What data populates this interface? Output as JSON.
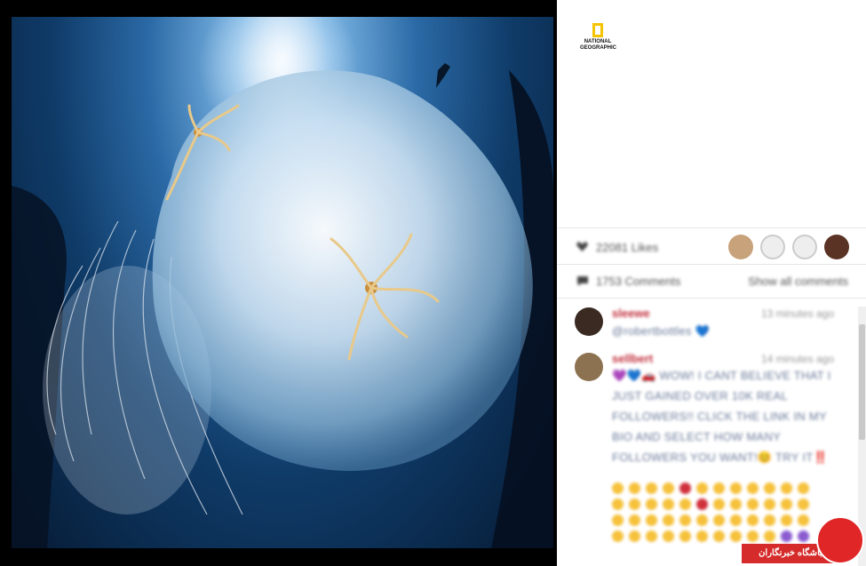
{
  "post": {
    "brand": "NATIONAL GEOGRAPHIC",
    "likes_text": "22081 Likes",
    "comments_text": "1753 Comments",
    "show_all_label": "Show all comments"
  },
  "comments": [
    {
      "user": "sleewe",
      "time": "13 minutes ago",
      "text": "@robertbottles 💙"
    },
    {
      "user": "sellbert",
      "time": "14 minutes ago",
      "text": "💜💙🚗 WOW! I CANT BELIEVE THAT I JUST GAINED OVER 10K REAL FOLLOWERS!! CLICK THE LINK IN MY BIO AND SELECT HOW MANY FOLLOWERS YOU WANT!😊 TRY IT‼️"
    }
  ],
  "watermark": {
    "text": "باشگاه خبرنگاران"
  },
  "colors": {
    "username": "#c2303c",
    "brand_yellow": "#f5c400",
    "watermark_red": "#d62b2b"
  }
}
